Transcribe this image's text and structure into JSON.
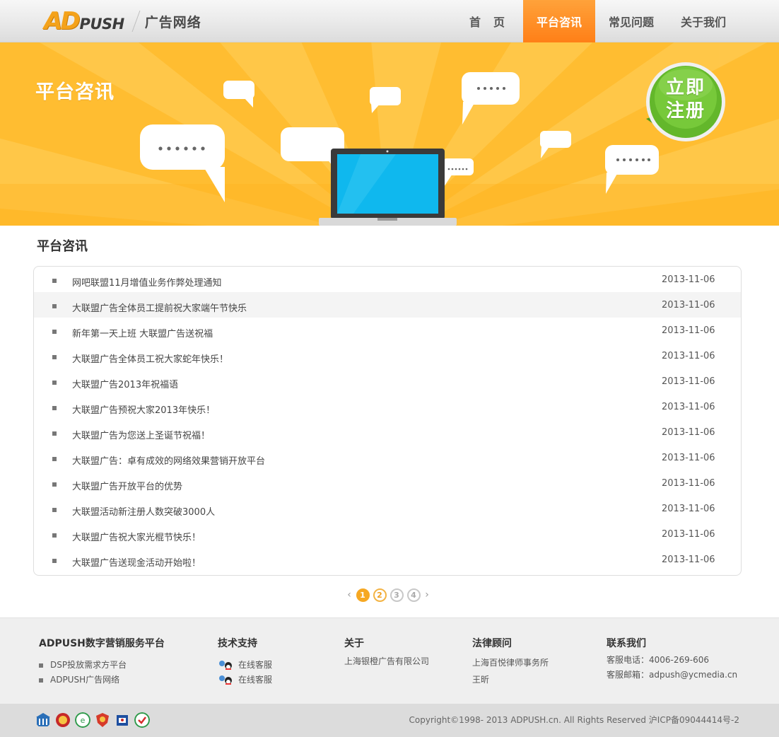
{
  "header": {
    "logo_ad": "AD",
    "logo_push": "PUSH",
    "logo_subtitle": "广告网络",
    "nav": [
      {
        "label": "首页",
        "active": false
      },
      {
        "label": "平台咨讯",
        "active": true
      },
      {
        "label": "常见问题",
        "active": false
      },
      {
        "label": "关于我们",
        "active": false
      }
    ]
  },
  "banner": {
    "title": "平台咨讯",
    "register_line1": "立即",
    "register_line2": "注册"
  },
  "section": {
    "title": "平台咨讯"
  },
  "news": [
    {
      "title": "网吧联盟11月增值业务作弊处理通知",
      "date": "2013-11-06"
    },
    {
      "title": "大联盟广告全体员工提前祝大家端午节快乐",
      "date": "2013-11-06"
    },
    {
      "title": "新年第一天上班 大联盟广告送祝福",
      "date": "2013-11-06"
    },
    {
      "title": "大联盟广告全体员工祝大家蛇年快乐！",
      "date": "2013-11-06"
    },
    {
      "title": "大联盟广告2013年祝福语",
      "date": "2013-11-06"
    },
    {
      "title": "大联盟广告预祝大家2013年快乐！",
      "date": "2013-11-06"
    },
    {
      "title": "大联盟广告为您送上圣诞节祝福！",
      "date": "2013-11-06"
    },
    {
      "title": "大联盟广告：卓有成效的网络效果营销开放平台",
      "date": "2013-11-06"
    },
    {
      "title": "大联盟广告开放平台的优势",
      "date": "2013-11-06"
    },
    {
      "title": "大联盟活动新注册人数突破3000人",
      "date": "2013-11-06"
    },
    {
      "title": "大联盟广告祝大家光棍节快乐！",
      "date": "2013-11-06"
    },
    {
      "title": "大联盟广告送现金活动开始啦！",
      "date": "2013-11-06"
    }
  ],
  "pagination": {
    "prev": "‹",
    "next": "›",
    "pages": [
      "1",
      "2",
      "3",
      "4"
    ],
    "current": "1"
  },
  "footer": {
    "col1": {
      "title": "ADPUSH数字营销服务平台",
      "items": [
        "DSP投放需求方平台",
        "ADPUSH广告网络"
      ]
    },
    "col2": {
      "title": "技术支持",
      "items": [
        "在线客服",
        "在线客服"
      ]
    },
    "col3": {
      "title": "关于",
      "items": [
        "上海银橙广告有限公司"
      ]
    },
    "col4": {
      "title": "法律顾问",
      "items": [
        "上海百悦律师事务所",
        "王昕"
      ]
    },
    "col5": {
      "title": "联系我们",
      "items": [
        "客服电话：4006-269-606",
        "客服邮箱：adpush@ycmedia.cn"
      ]
    },
    "copyright": "Copyright©1998- 2013 ADPUSH.cn. All Rights Reserved 沪ICP备09044414号-2"
  },
  "colors": {
    "accent": "#ff8a1f",
    "banner": "#ffbd31",
    "register_green": "#6cc02a"
  }
}
